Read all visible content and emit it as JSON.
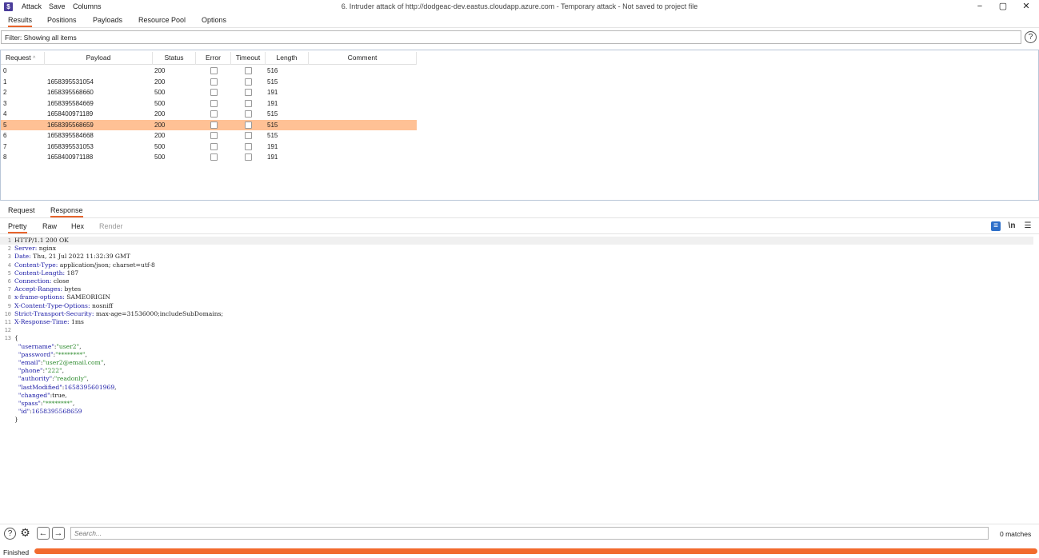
{
  "menu": {
    "logo": "$",
    "items": [
      "Attack",
      "Save",
      "Columns"
    ]
  },
  "window": {
    "title": "6. Intruder attack of http://dodgeac-dev.eastus.cloudapp.azure.com - Temporary attack - Not saved to project file",
    "minimize": "−",
    "maximize": "▢",
    "close": "✕"
  },
  "main_tabs": [
    "Results",
    "Positions",
    "Payloads",
    "Resource Pool",
    "Options"
  ],
  "active_main_tab": "Results",
  "filter": {
    "text": "Filter: Showing all items",
    "help": "?"
  },
  "table": {
    "columns": [
      "Request",
      "Payload",
      "Status",
      "Error",
      "Timeout",
      "Length",
      "Comment"
    ],
    "sort_indicator": "^",
    "rows": [
      {
        "request": "0",
        "payload": "",
        "status": "200",
        "error": false,
        "timeout": false,
        "length": "516",
        "comment": ""
      },
      {
        "request": "1",
        "payload": "1658395531054",
        "status": "200",
        "error": false,
        "timeout": false,
        "length": "515",
        "comment": ""
      },
      {
        "request": "2",
        "payload": "1658395568660",
        "status": "500",
        "error": false,
        "timeout": false,
        "length": "191",
        "comment": ""
      },
      {
        "request": "3",
        "payload": "1658395584669",
        "status": "500",
        "error": false,
        "timeout": false,
        "length": "191",
        "comment": ""
      },
      {
        "request": "4",
        "payload": "1658400971189",
        "status": "200",
        "error": false,
        "timeout": false,
        "length": "515",
        "comment": ""
      },
      {
        "request": "5",
        "payload": "1658395568659",
        "status": "200",
        "error": false,
        "timeout": false,
        "length": "515",
        "comment": "",
        "selected": true
      },
      {
        "request": "6",
        "payload": "1658395584668",
        "status": "200",
        "error": false,
        "timeout": false,
        "length": "515",
        "comment": ""
      },
      {
        "request": "7",
        "payload": "1658395531053",
        "status": "500",
        "error": false,
        "timeout": false,
        "length": "191",
        "comment": ""
      },
      {
        "request": "8",
        "payload": "1658400971188",
        "status": "500",
        "error": false,
        "timeout": false,
        "length": "191",
        "comment": ""
      }
    ]
  },
  "rr_tabs": [
    "Request",
    "Response"
  ],
  "active_rr_tab": "Response",
  "view_tabs": [
    "Pretty",
    "Raw",
    "Hex",
    "Render"
  ],
  "active_view_tab": "Pretty",
  "view_icons": {
    "wrap": "≡",
    "newline": "\\n",
    "menu": "☰"
  },
  "response_lines": [
    "HTTP/1.1 200 OK",
    "Server: nginx",
    "Date: Thu, 21 Jul 2022 11:32:39 GMT",
    "Content-Type: application/json; charset=utf-8",
    "Content-Length: 187",
    "Connection: close",
    "Accept-Ranges: bytes",
    "x-frame-options: SAMEORIGIN",
    "X-Content-Type-Options: nosniff",
    "Strict-Transport-Security: max-age=31536000;includeSubDomains;",
    "X-Response-Time: 1ms",
    "",
    "{"
  ],
  "json_body": [
    {
      "key": "\"username\"",
      "value": "\"user2\"",
      "type": "str",
      "comma": ","
    },
    {
      "key": "\"password\"",
      "value": "\"********\"",
      "type": "str",
      "comma": ","
    },
    {
      "key": "\"email\"",
      "value": "\"user2@email.com\"",
      "type": "str",
      "comma": ","
    },
    {
      "key": "\"phone\"",
      "value": "\"222\"",
      "type": "str",
      "comma": ","
    },
    {
      "key": "\"authority\"",
      "value": "\"readonly\"",
      "type": "str",
      "comma": ","
    },
    {
      "key": "\"lastModified\"",
      "value": "1658395601969",
      "type": "num",
      "comma": ","
    },
    {
      "key": "\"changed\"",
      "value": "true",
      "type": "plain",
      "comma": ","
    },
    {
      "key": "\"spass\"",
      "value": "\"********\"",
      "type": "str",
      "comma": ","
    },
    {
      "key": "\"id\"",
      "value": "1658395568659",
      "type": "num",
      "comma": ""
    }
  ],
  "json_close": "}",
  "bottom": {
    "help": "?",
    "settings": "⚙",
    "back": "←",
    "forward": "→",
    "search_placeholder": "Search...",
    "matches": "0 matches"
  },
  "status": {
    "text": "Finished",
    "progress": 1.0
  },
  "colors": {
    "accent": "#e8642c",
    "selected_row": "#ffc195",
    "progress": "#f26a2e"
  }
}
